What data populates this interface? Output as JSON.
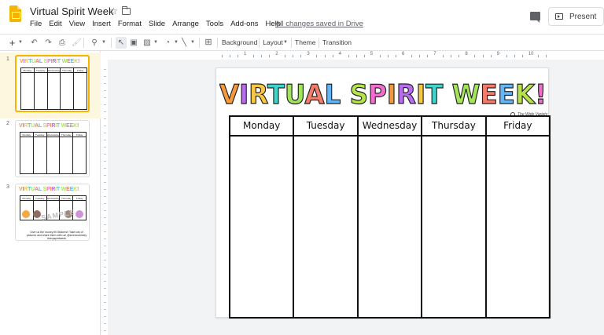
{
  "app": {
    "title": "Virtual Spirit Week",
    "saved_status": "All changes saved in Drive",
    "present_label": "Present"
  },
  "menu": [
    "File",
    "Edit",
    "View",
    "Insert",
    "Format",
    "Slide",
    "Arrange",
    "Tools",
    "Add-ons",
    "Help"
  ],
  "toolbar": {
    "background_label": "Background",
    "layout_label": "Layout",
    "theme_label": "Theme",
    "transition_label": "Transition"
  },
  "ruler": {
    "numbers": [
      "1",
      "2",
      "3",
      "4",
      "5",
      "6",
      "7",
      "8",
      "9",
      "10"
    ]
  },
  "filmstrip": {
    "slides": [
      {
        "number": "1",
        "selected": true
      },
      {
        "number": "2",
        "selected": false
      },
      {
        "number": "3",
        "selected": false
      }
    ],
    "thumb3_sample": "SAMPLE",
    "thumb3_footer": "Give us the money fill Stickers!! Take lots of pictures and share them with us! @lorenmckinley #veryspiritweek"
  },
  "slide": {
    "title": "VIRTUAL SPIRIT WEEK!",
    "title_colors": [
      "#f59a3b",
      "#b96cf0",
      "#f7c842",
      "#3fd3c9",
      "#a3e45a",
      "#f47c6a",
      "#64b5f6",
      "#b4e34a",
      "#f26fd0"
    ],
    "brand": "The Wide Variety",
    "days": [
      "Monday",
      "Tuesday",
      "Wednesday",
      "Thursday",
      "Friday"
    ]
  },
  "colors": {
    "accent": "#f4b400",
    "selected_bg": "#fef7e0",
    "canvas_bg": "#f1f3f4"
  }
}
